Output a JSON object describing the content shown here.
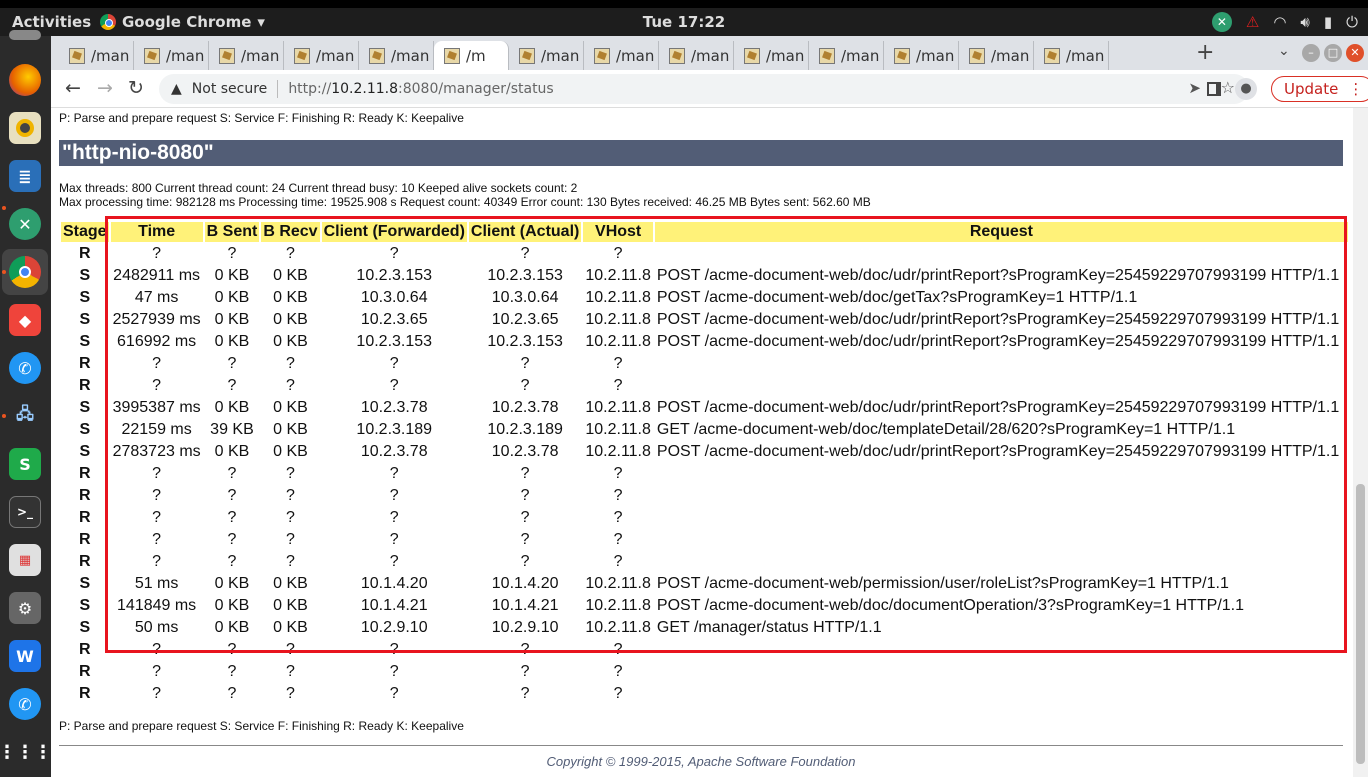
{
  "topbar": {
    "activities": "Activities",
    "app_name": "Google Chrome",
    "clock": "Tue 17:22",
    "tray_icons": [
      "xmind-icon",
      "warning-icon",
      "wifi-icon",
      "volume-icon",
      "battery-icon",
      "power-icon"
    ]
  },
  "dock": {
    "apps": [
      "firefox-icon",
      "rhythmbox-icon",
      "libreoffice-writer-icon",
      "xmind-icon",
      "chrome-icon",
      "anydesk-icon",
      "phone-icon",
      "network-icon",
      "sheets-icon",
      "terminal-icon",
      "calculator-icon",
      "settings-icon",
      "wps-icon",
      "phone-icon",
      "app-grid-icon"
    ]
  },
  "browser": {
    "tabs": [
      {
        "label": "/man"
      },
      {
        "label": "/man"
      },
      {
        "label": "/man"
      },
      {
        "label": "/man"
      },
      {
        "label": "/man"
      },
      {
        "label": "/m",
        "active": true
      },
      {
        "label": "/man"
      },
      {
        "label": "/man"
      },
      {
        "label": "/man"
      },
      {
        "label": "/man"
      },
      {
        "label": "/man"
      },
      {
        "label": "/man"
      },
      {
        "label": "/man"
      },
      {
        "label": "/man"
      }
    ],
    "security_label": "Not secure",
    "url_prefix": "http://",
    "url_host": "10.2.11.8",
    "url_rest": ":8080/manager/status",
    "update_label": "Update"
  },
  "page": {
    "legend_top": "P: Parse and prepare request S: Service F: Finishing R: Ready K: Keepalive",
    "connector_name": "\"http-nio-8080\"",
    "stats_line1": "Max threads: 800 Current thread count: 24 Current thread busy: 10 Keeped alive sockets count: 2",
    "stats_line2": "Max processing time: 982128 ms Processing time: 19525.908 s Request count: 40349 Error count: 130 Bytes received: 46.25 MB Bytes sent: 562.60 MB",
    "columns": [
      "Stage",
      "Time",
      "B Sent",
      "B Recv",
      "Client (Forwarded)",
      "Client (Actual)",
      "VHost",
      "Request"
    ],
    "rows": [
      [
        "R",
        "?",
        "?",
        "?",
        "?",
        "?",
        "?",
        ""
      ],
      [
        "S",
        "2482911 ms",
        "0 KB",
        "0 KB",
        "10.2.3.153",
        "10.2.3.153",
        "10.2.11.8",
        "POST /acme-document-web/doc/udr/printReport?sProgramKey=25459229707993199 HTTP/1.1"
      ],
      [
        "S",
        "47 ms",
        "0 KB",
        "0 KB",
        "10.3.0.64",
        "10.3.0.64",
        "10.2.11.8",
        "POST /acme-document-web/doc/getTax?sProgramKey=1 HTTP/1.1"
      ],
      [
        "S",
        "2527939 ms",
        "0 KB",
        "0 KB",
        "10.2.3.65",
        "10.2.3.65",
        "10.2.11.8",
        "POST /acme-document-web/doc/udr/printReport?sProgramKey=25459229707993199 HTTP/1.1"
      ],
      [
        "S",
        "616992 ms",
        "0 KB",
        "0 KB",
        "10.2.3.153",
        "10.2.3.153",
        "10.2.11.8",
        "POST /acme-document-web/doc/udr/printReport?sProgramKey=25459229707993199 HTTP/1.1"
      ],
      [
        "R",
        "?",
        "?",
        "?",
        "?",
        "?",
        "?",
        ""
      ],
      [
        "R",
        "?",
        "?",
        "?",
        "?",
        "?",
        "?",
        ""
      ],
      [
        "S",
        "3995387 ms",
        "0 KB",
        "0 KB",
        "10.2.3.78",
        "10.2.3.78",
        "10.2.11.8",
        "POST /acme-document-web/doc/udr/printReport?sProgramKey=25459229707993199 HTTP/1.1"
      ],
      [
        "S",
        "22159 ms",
        "39 KB",
        "0 KB",
        "10.2.3.189",
        "10.2.3.189",
        "10.2.11.8",
        "GET /acme-document-web/doc/templateDetail/28/620?sProgramKey=1 HTTP/1.1"
      ],
      [
        "S",
        "2783723 ms",
        "0 KB",
        "0 KB",
        "10.2.3.78",
        "10.2.3.78",
        "10.2.11.8",
        "POST /acme-document-web/doc/udr/printReport?sProgramKey=25459229707993199 HTTP/1.1"
      ],
      [
        "R",
        "?",
        "?",
        "?",
        "?",
        "?",
        "?",
        ""
      ],
      [
        "R",
        "?",
        "?",
        "?",
        "?",
        "?",
        "?",
        ""
      ],
      [
        "R",
        "?",
        "?",
        "?",
        "?",
        "?",
        "?",
        ""
      ],
      [
        "R",
        "?",
        "?",
        "?",
        "?",
        "?",
        "?",
        ""
      ],
      [
        "R",
        "?",
        "?",
        "?",
        "?",
        "?",
        "?",
        ""
      ],
      [
        "S",
        "51 ms",
        "0 KB",
        "0 KB",
        "10.1.4.20",
        "10.1.4.20",
        "10.2.11.8",
        "POST /acme-document-web/permission/user/roleList?sProgramKey=1 HTTP/1.1"
      ],
      [
        "S",
        "141849 ms",
        "0 KB",
        "0 KB",
        "10.1.4.21",
        "10.1.4.21",
        "10.2.11.8",
        "POST /acme-document-web/doc/documentOperation/3?sProgramKey=1 HTTP/1.1"
      ],
      [
        "S",
        "50 ms",
        "0 KB",
        "0 KB",
        "10.2.9.10",
        "10.2.9.10",
        "10.2.11.8",
        "GET /manager/status HTTP/1.1"
      ],
      [
        "R",
        "?",
        "?",
        "?",
        "?",
        "?",
        "?",
        ""
      ],
      [
        "R",
        "?",
        "?",
        "?",
        "?",
        "?",
        "?",
        ""
      ],
      [
        "R",
        "?",
        "?",
        "?",
        "?",
        "?",
        "?",
        ""
      ]
    ],
    "legend_bottom": "P: Parse and prepare request S: Service F: Finishing R: Ready K: Keepalive",
    "copyright": "Copyright © 1999-2015, Apache Software Foundation",
    "highlight_color": "#e8141e"
  }
}
